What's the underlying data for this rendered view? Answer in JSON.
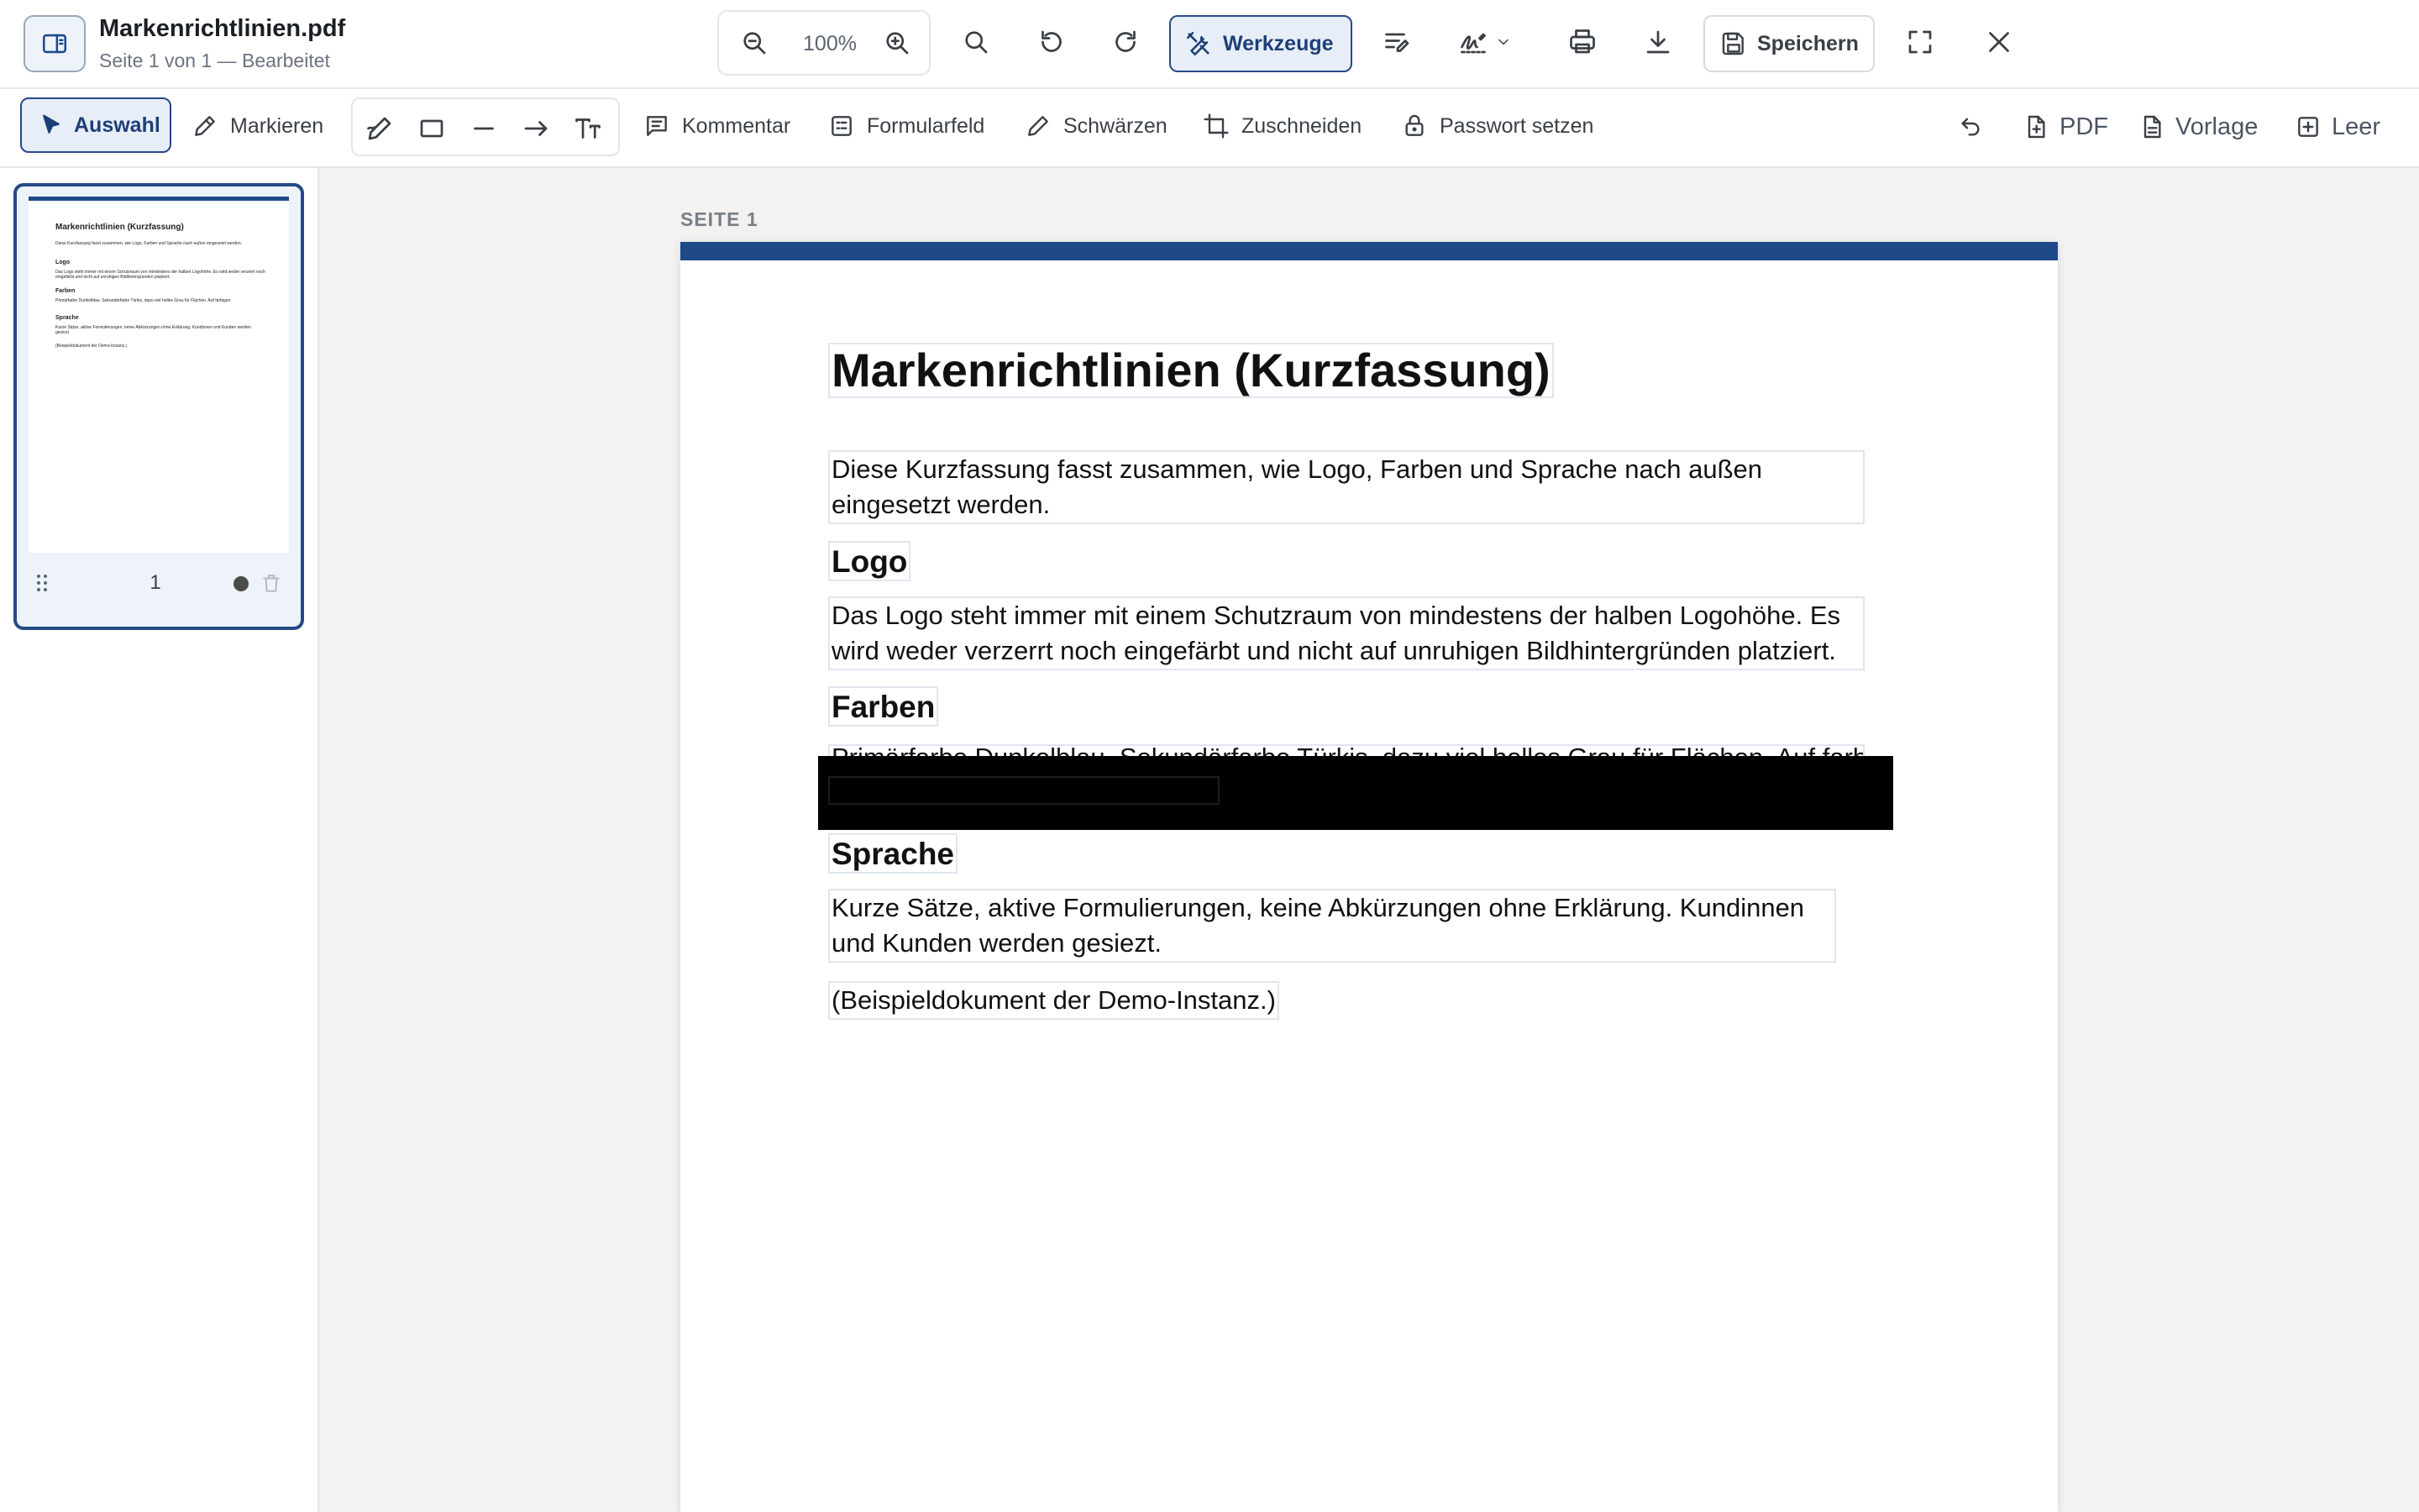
{
  "header": {
    "file_name": "Markenrichtlinien.pdf",
    "status": "Seite 1 von 1 — Bearbeitet",
    "zoom": "100%",
    "tools_label": "Werkzeuge",
    "save_label": "Speichern"
  },
  "toolbar": {
    "select_label": "Auswahl",
    "highlight_label": "Markieren",
    "comment_label": "Kommentar",
    "form_field_label": "Formularfeld",
    "redact_label": "Schwärzen",
    "crop_label": "Zuschneiden",
    "password_label": "Passwort setzen",
    "pdf_label": "PDF",
    "template_label": "Vorlage",
    "blank_label": "Leer"
  },
  "thumbnails": {
    "page_number": "1"
  },
  "document": {
    "page_label": "SEITE 1",
    "title": "Markenrichtlinien (Kurzfassung)",
    "intro": "Diese Kurzfassung fasst zusammen, wie Logo, Farben und Sprache nach außen eingesetzt werden.",
    "logo_heading": "Logo",
    "logo_text": "Das Logo steht immer mit einem Schutzraum von mindestens der halben Logohöhe. Es wird weder verzerrt noch eingefärbt und nicht auf unruhigen Bildhintergründen platziert.",
    "farben_heading": "Farben",
    "farben_text_partial": "Primärfarbe Dunkelblau. Sekundärfarbe Türkis, dazu viel helles Grau für Flächen. Auf farbigen",
    "sprache_heading": "Sprache",
    "sprache_text": "Kurze Sätze, aktive Formulierungen, keine Abkürzungen ohne Erklärung. Kundinnen und Kunden werden gesiezt.",
    "footer_note": "(Beispieldokument der Demo-Instanz.)"
  },
  "colors": {
    "accent": "#1f4a8a",
    "active_bg": "#e7eef8",
    "redaction": "#000000"
  },
  "icons": [
    "sidebar-toggle-icon",
    "zoom-out-icon",
    "zoom-in-icon",
    "search-icon",
    "rotate-left-icon",
    "rotate-right-icon",
    "tools-icon",
    "text-edit-icon",
    "signature-icon",
    "chevron-down-icon",
    "print-icon",
    "download-icon",
    "save-icon",
    "fullscreen-icon",
    "close-icon",
    "cursor-icon",
    "pen-icon",
    "draw-icon",
    "rectangle-icon",
    "line-icon",
    "arrow-icon",
    "text-size-icon",
    "comment-icon",
    "form-field-icon",
    "redact-pen-icon",
    "crop-icon",
    "lock-icon",
    "undo-icon",
    "pdf-file-icon",
    "template-file-icon",
    "blank-page-icon",
    "drag-handle-icon",
    "trash-icon"
  ]
}
